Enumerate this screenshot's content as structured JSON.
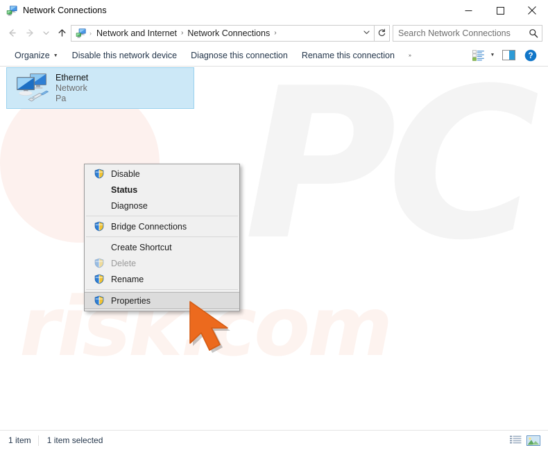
{
  "window": {
    "title": "Network Connections",
    "title_icon": "network-connections-icon",
    "minimize_label": "–",
    "maximize_label": "❐",
    "close_label": "✕"
  },
  "navbar": {
    "back_label": "←",
    "forward_label": "→",
    "recent_label": "∨",
    "up_label": "↑",
    "breadcrumbs": [
      {
        "label": "Network and Internet"
      },
      {
        "label": "Network Connections"
      }
    ],
    "breadcrumb_separator": "›",
    "dropdown_label": "∨",
    "refresh_label": "↻",
    "refresh_icon": "refresh-icon"
  },
  "search": {
    "placeholder": "Search Network Connections",
    "value": "",
    "icon": "search-icon"
  },
  "commandbar": {
    "items": [
      {
        "label": "Organize",
        "has_caret": true
      },
      {
        "label": "Disable this network device",
        "has_caret": false
      },
      {
        "label": "Diagnose this connection",
        "has_caret": false
      },
      {
        "label": "Rename this connection",
        "has_caret": false
      }
    ],
    "overflow_label": "»",
    "icons": [
      {
        "name": "change-view-icon",
        "has_caret": true
      },
      {
        "name": "preview-pane-icon",
        "has_caret": false
      },
      {
        "name": "help-icon",
        "has_caret": false
      }
    ]
  },
  "connections": [
    {
      "name": "Ethernet",
      "network": "Network",
      "adapter": "Pa",
      "icon": "ethernet-adapter-icon",
      "selected": true
    }
  ],
  "context_menu": {
    "items": [
      {
        "label": "Disable",
        "shield": true,
        "bold": false,
        "disabled": false,
        "highlight": false
      },
      {
        "label": "Status",
        "shield": false,
        "bold": true,
        "disabled": false,
        "highlight": false
      },
      {
        "label": "Diagnose",
        "shield": false,
        "bold": false,
        "disabled": false,
        "highlight": false
      },
      {
        "separator": true
      },
      {
        "label": "Bridge Connections",
        "shield": true,
        "bold": false,
        "disabled": false,
        "highlight": false
      },
      {
        "separator": true
      },
      {
        "label": "Create Shortcut",
        "shield": false,
        "bold": false,
        "disabled": false,
        "highlight": false
      },
      {
        "label": "Delete",
        "shield": true,
        "bold": false,
        "disabled": true,
        "highlight": false
      },
      {
        "label": "Rename",
        "shield": true,
        "bold": false,
        "disabled": false,
        "highlight": false
      },
      {
        "separator": true
      },
      {
        "label": "Properties",
        "shield": true,
        "bold": false,
        "disabled": false,
        "highlight": true
      }
    ]
  },
  "statusbar": {
    "item_count": "1 item",
    "selection": "1 item selected",
    "views": [
      {
        "name": "details-view-icon"
      },
      {
        "name": "large-icons-view-icon"
      }
    ]
  },
  "watermarks": {
    "logo_text": "PC",
    "site_text": "risk.com"
  },
  "colors": {
    "selection_bg": "#cce8f7",
    "selection_border": "#99d1ee",
    "menu_bg": "#f0f0f0",
    "menu_border": "#9a9a9a",
    "menu_highlight": "#dcdcdc",
    "cursor": "#ec6a1e",
    "accent_text": "#24364b",
    "help_blue": "#1176c8"
  },
  "cursor": {
    "name": "mouse-pointer-arrow",
    "color": "#ec6a1e"
  }
}
